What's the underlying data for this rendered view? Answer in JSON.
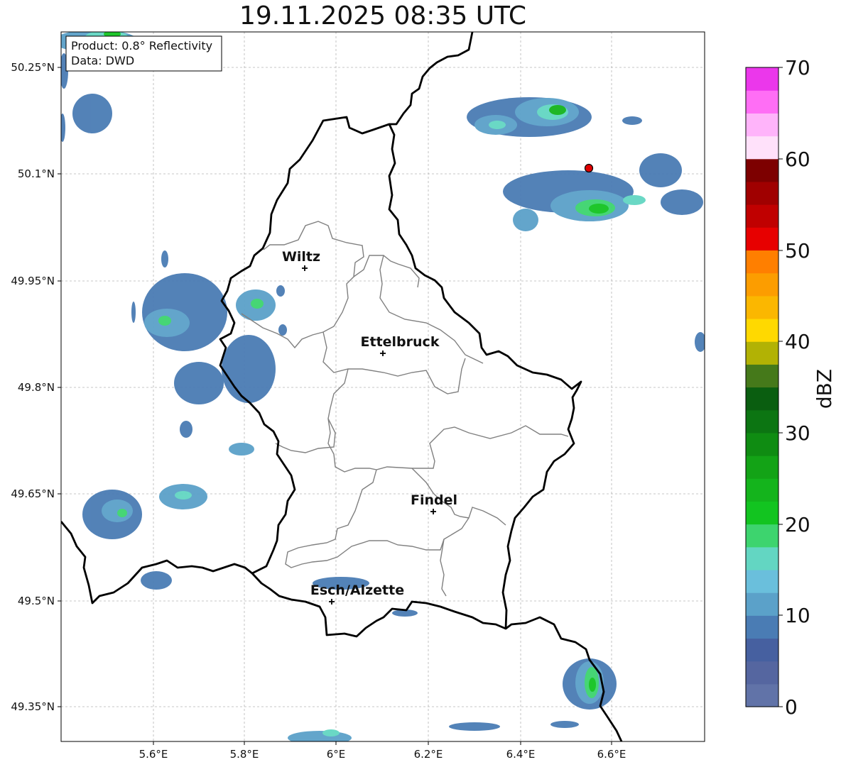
{
  "title": "19.11.2025 08:35 UTC",
  "info_box": {
    "product": "Product: 0.8° Reflectivity",
    "source": "Data: DWD"
  },
  "lon_ticks": [
    "5.6°E",
    "5.8°E",
    "6°E",
    "6.2°E",
    "6.4°E",
    "6.6°E"
  ],
  "lat_ticks": [
    "50.25°N",
    "50.1°N",
    "49.95°N",
    "49.8°N",
    "49.65°N",
    "49.5°N",
    "49.35°N"
  ],
  "cities": [
    {
      "name": "Wiltz"
    },
    {
      "name": "Ettelbruck"
    },
    {
      "name": "Findel"
    },
    {
      "name": "Esch/Alzette"
    }
  ],
  "colorbar": {
    "label": "dBZ",
    "ticks": [
      "0",
      "10",
      "20",
      "30",
      "40",
      "50",
      "60",
      "70"
    ],
    "colors": [
      "#6173a8",
      "#5566a0",
      "#4660a0",
      "#4a7cb4",
      "#5ba1c9",
      "#6abfdc",
      "#63d6c2",
      "#3dd46e",
      "#12c420",
      "#14b41c",
      "#13a316",
      "#0f8c12",
      "#0c7512",
      "#0a5e10",
      "#45791a",
      "#b2b204",
      "#ffd900",
      "#fbb700",
      "#fc9d00",
      "#ff7f00",
      "#e70000",
      "#c00000",
      "#a00000",
      "#7d0000",
      "#ffe1fa",
      "#ffb4fa",
      "#ff6ef5",
      "#eb37eb"
    ]
  },
  "colors": {
    "border": "#000000",
    "cantons": "#808080",
    "grid": "#b5b5b5",
    "marker": "#e00000"
  }
}
